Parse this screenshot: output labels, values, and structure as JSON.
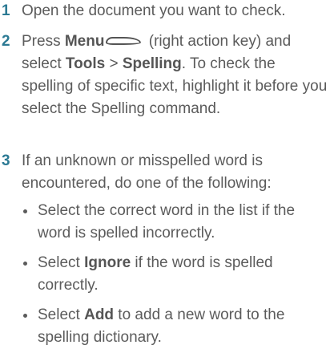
{
  "steps": [
    {
      "number": "1",
      "text": "Open the document you want to check."
    },
    {
      "number": "2",
      "part1": "Press ",
      "menu": "Menu",
      "part2": " (right action key) and select ",
      "tools": "Tools",
      "sep": " > ",
      "spelling": "Spelling",
      "part3": ". To check the spelling of specific text, highlight it before you select the Spelling command.",
      "key_icon": "menu-key-icon"
    },
    {
      "number": "3",
      "text": "If an unknown or misspelled word is encountered, do one of the following:",
      "bullets": [
        {
          "text": "Select the correct word in the list if the word is spelled incorrectly."
        },
        {
          "pre": "Select ",
          "bold": "Ignore",
          "post": " if the word is spelled correctly."
        },
        {
          "pre": "Select ",
          "bold": "Add",
          "post": " to add a new word to the spelling dictionary."
        }
      ]
    }
  ]
}
